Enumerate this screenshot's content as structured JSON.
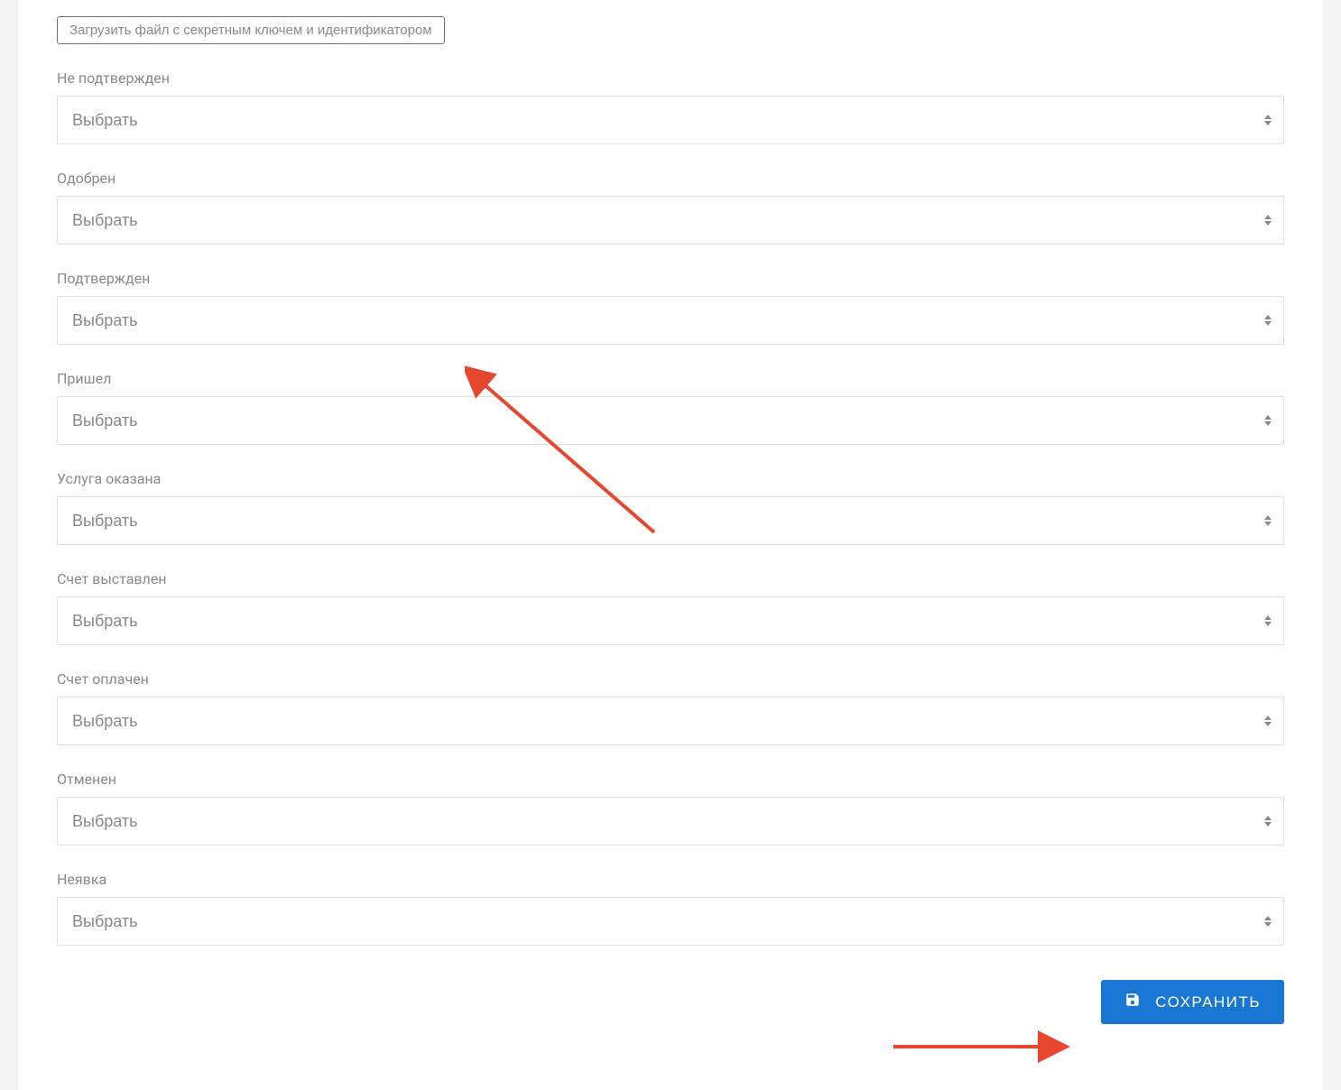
{
  "upload_button_label": "Загрузить файл с секретным ключем и идентификатором",
  "select_placeholder": "Выбрать",
  "fields": {
    "not_confirmed": {
      "label": "Не подтвержден"
    },
    "approved": {
      "label": "Одобрен"
    },
    "confirmed": {
      "label": "Подтвержден"
    },
    "arrived": {
      "label": "Пришел"
    },
    "service_done": {
      "label": "Услуга оказана"
    },
    "invoice_issued": {
      "label": "Счет выставлен"
    },
    "invoice_paid": {
      "label": "Счет оплачен"
    },
    "cancelled": {
      "label": "Отменен"
    },
    "no_show": {
      "label": "Неявка"
    }
  },
  "save_button_label": "СОХРАНИТЬ",
  "annotation_color": "#e8472f"
}
